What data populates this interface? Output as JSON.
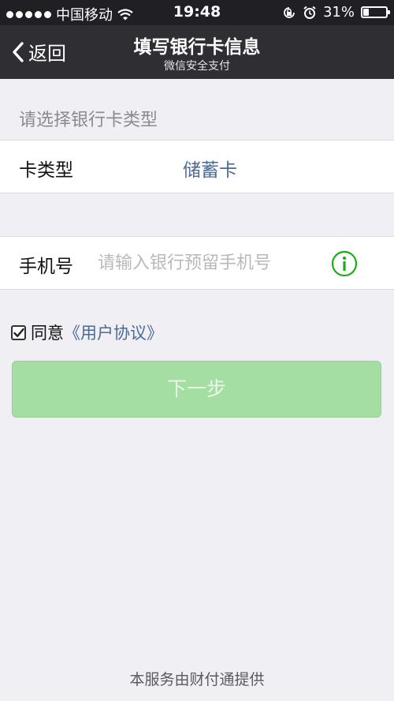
{
  "status_bar": {
    "carrier": "中国移动",
    "time": "19:48",
    "battery_percent": "31%",
    "battery_level": 0.31
  },
  "nav": {
    "back_label": "返回",
    "title": "填写银行卡信息",
    "subtitle": "微信安全支付"
  },
  "section": {
    "header": "请选择银行卡类型"
  },
  "card_type": {
    "label": "卡类型",
    "value": "储蓄卡"
  },
  "phone": {
    "label": "手机号",
    "value": "",
    "placeholder": "请输入银行预留手机号"
  },
  "agreement": {
    "checked": true,
    "prefix": "同意",
    "link_text": "《用户协议》"
  },
  "next_button": {
    "label": "下一步"
  },
  "footer": {
    "text": "本服务由财付通提供"
  },
  "colors": {
    "nav_background": "#2e2e33",
    "accent_link": "#4b6a96",
    "button_disabled_green": "#a5dea3",
    "info_icon_green": "#1aad19"
  }
}
